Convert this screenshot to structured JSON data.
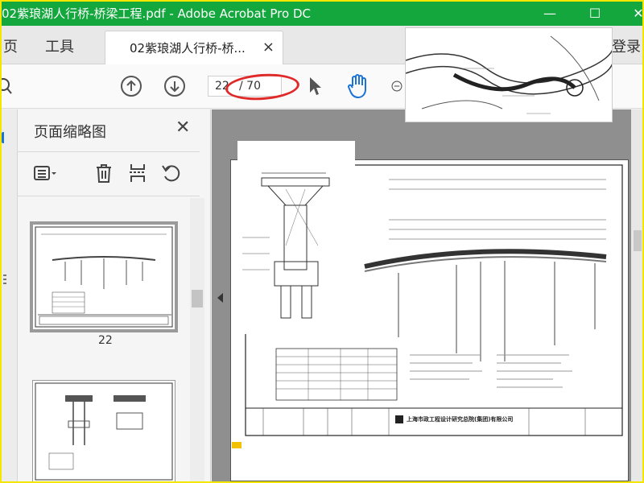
{
  "window": {
    "title": "02紫琅湖人行桥-桥梁工程.pdf - Adobe Acrobat Pro DC",
    "controls": {
      "minimize": "—",
      "maximize": "☐",
      "close": "✕"
    }
  },
  "tabs": {
    "home": "页",
    "tools": "工具",
    "document": "02紫琅湖人行桥-桥...",
    "close": "×",
    "sign_in": "登录"
  },
  "toolbar": {
    "page_current": "22",
    "page_total": "/ 70"
  },
  "sidebar": {
    "title": "页面缩略图",
    "close": "✕",
    "thumbnails": [
      {
        "label": "22"
      }
    ]
  },
  "document": {
    "company": "上海市政工程设计研究总院(集团)有限公司"
  },
  "colors": {
    "titlebar": "#14a73d",
    "frame": "#f5e600",
    "annotation": "#e02a2a",
    "hand_tool": "#1a73d9"
  }
}
